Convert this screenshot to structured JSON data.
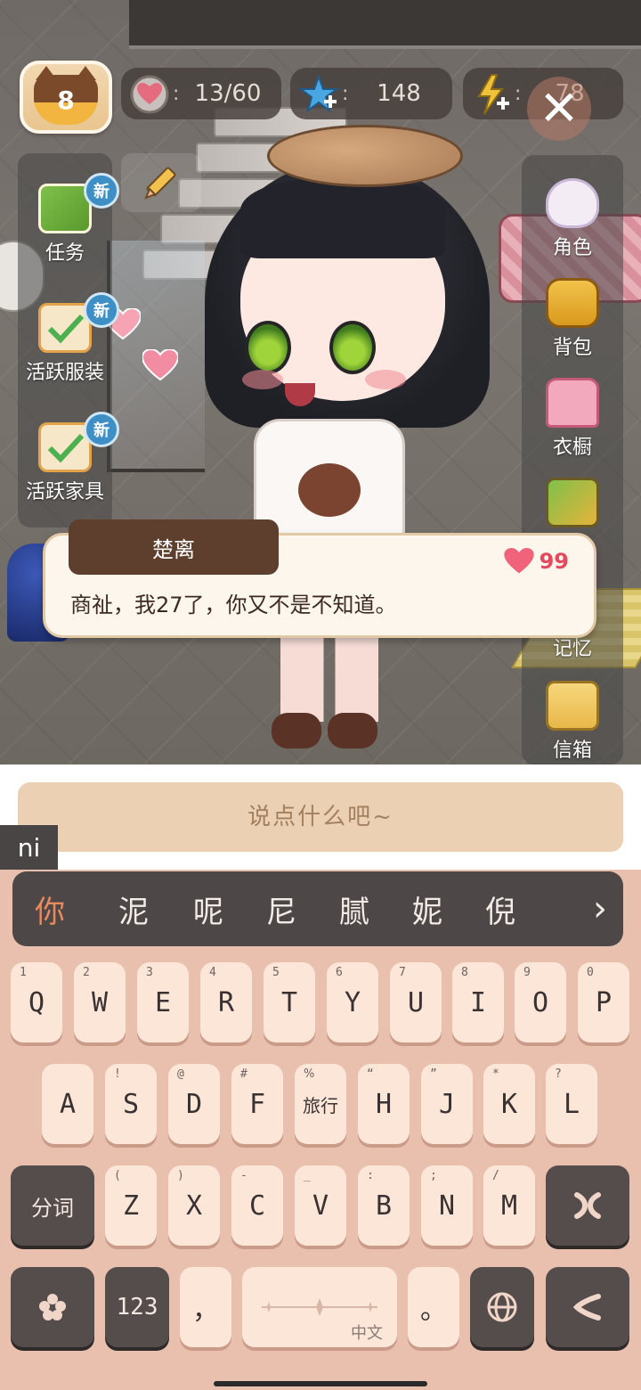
{
  "hud": {
    "level": "8",
    "hearts": "13/60",
    "stars": "148",
    "energy": "78",
    "separator": ":"
  },
  "left_menu": [
    {
      "label": "任务",
      "badge": "新"
    },
    {
      "label": "活跃服装",
      "badge": "新"
    },
    {
      "label": "活跃家具",
      "badge": "新"
    }
  ],
  "right_menu": [
    {
      "label": "角色"
    },
    {
      "label": "背包"
    },
    {
      "label": "衣橱"
    },
    {
      "label": "记忆"
    },
    {
      "label": "信箱"
    }
  ],
  "dialog": {
    "speaker": "楚离",
    "message": "商祉，我27了，你又不是不知道。",
    "affection": "99"
  },
  "chat": {
    "placeholder": "说点什么吧~"
  },
  "ime": {
    "composing": "ni",
    "candidates": [
      "你",
      "泥",
      "呢",
      "尼",
      "腻",
      "妮",
      "倪"
    ],
    "label_cn": "中文"
  },
  "keyboard": {
    "row1": [
      {
        "k": "Q",
        "s": "1"
      },
      {
        "k": "W",
        "s": "2"
      },
      {
        "k": "E",
        "s": "3"
      },
      {
        "k": "R",
        "s": "4"
      },
      {
        "k": "T",
        "s": "5"
      },
      {
        "k": "Y",
        "s": "6"
      },
      {
        "k": "U",
        "s": "7"
      },
      {
        "k": "I",
        "s": "8"
      },
      {
        "k": "O",
        "s": "9"
      },
      {
        "k": "P",
        "s": "0"
      }
    ],
    "row2": [
      {
        "k": "A",
        "s": ""
      },
      {
        "k": "S",
        "s": "!"
      },
      {
        "k": "D",
        "s": "@"
      },
      {
        "k": "F",
        "s": "#"
      },
      {
        "k": "旅行",
        "s": "%"
      },
      {
        "k": "H",
        "s": "“"
      },
      {
        "k": "J",
        "s": "”"
      },
      {
        "k": "K",
        "s": "*"
      },
      {
        "k": "L",
        "s": "?"
      }
    ],
    "row3": [
      {
        "k": "Z",
        "s": "("
      },
      {
        "k": "X",
        "s": ")"
      },
      {
        "k": "C",
        "s": "-"
      },
      {
        "k": "V",
        "s": "_"
      },
      {
        "k": "B",
        "s": ":"
      },
      {
        "k": "N",
        "s": ";"
      },
      {
        "k": "M",
        "s": "/"
      }
    ],
    "fenci": "分词",
    "num_key": "123",
    "comma": "，",
    "period": "。"
  },
  "colors": {
    "keyboard_bg": "#e9bfae",
    "key_face": "#fbe6d8",
    "dark_key": "#554c4c",
    "candidate_selected": "#e98a5e",
    "dialog_name_bg": "#5e3f2e",
    "new_badge": "#3f8fc7",
    "heart": "#e24a5f"
  }
}
